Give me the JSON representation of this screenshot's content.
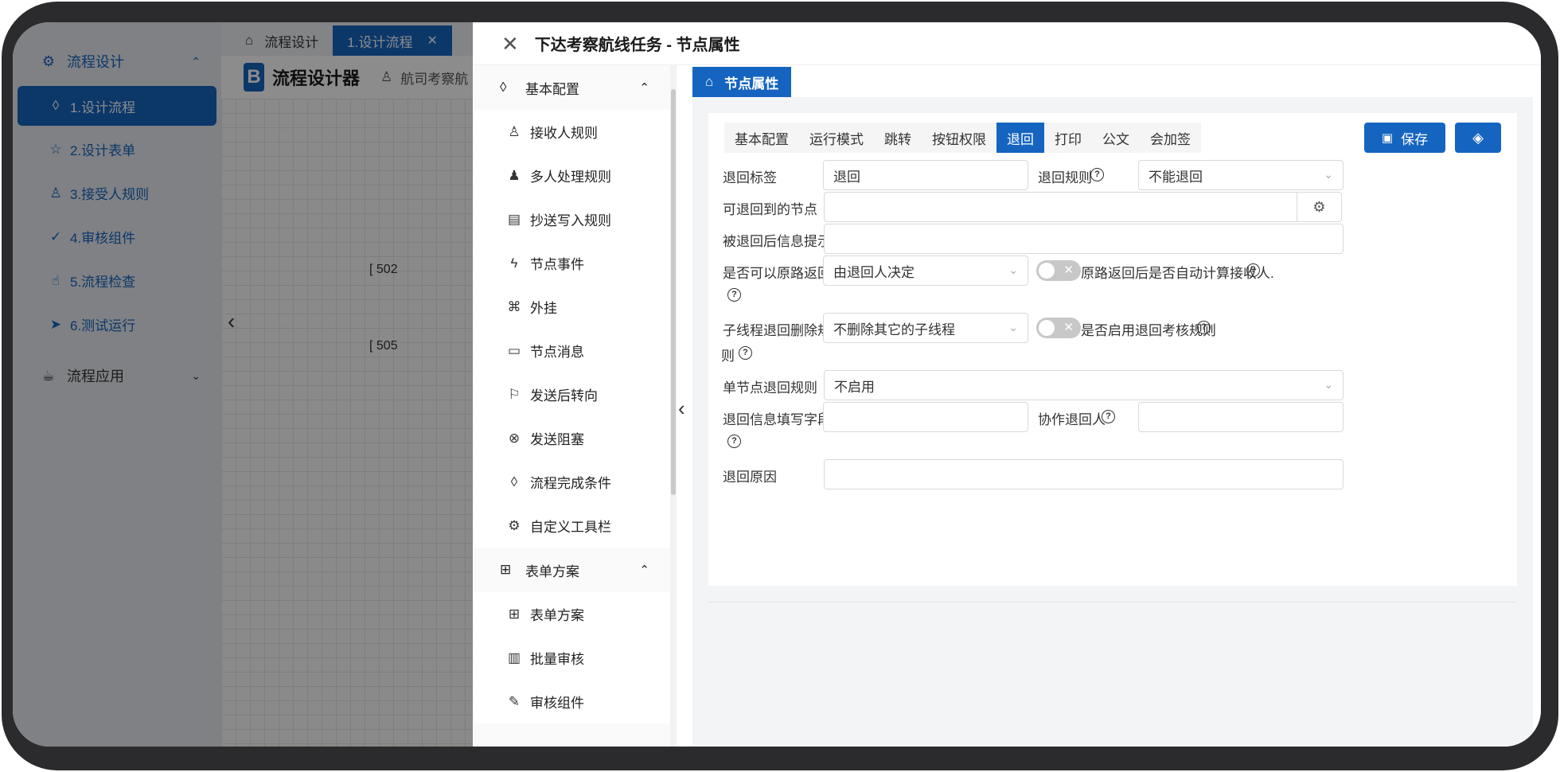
{
  "app": {
    "sidebar": {
      "group1": "流程设计",
      "items": [
        {
          "label": "1.设计流程",
          "icon": "droplet-icon"
        },
        {
          "label": "2.设计表单",
          "icon": "star-icon"
        },
        {
          "label": "3.接受人规则",
          "icon": "user-icon"
        },
        {
          "label": "4.审核组件",
          "icon": "check-circle-icon"
        },
        {
          "label": "5.流程检查",
          "icon": "thumb-icon"
        },
        {
          "label": "6.测试运行",
          "icon": "send-icon"
        }
      ],
      "group2": "流程应用"
    },
    "tabs": {
      "home": "流程设计",
      "active": "1.设计流程"
    },
    "designer": {
      "logo": "B",
      "title": "流程设计器",
      "subtitle": "航司考察航"
    },
    "canvas": {
      "node1": "[ 502",
      "node2": "[ 505"
    }
  },
  "drawer": {
    "title": "下达考察航线任务 - 节点属性",
    "nav": {
      "group_basic": "基本配置",
      "items": [
        {
          "label": "接收人规则",
          "icon": "user-icon"
        },
        {
          "label": "多人处理规则",
          "icon": "users-icon"
        },
        {
          "label": "抄送写入规则",
          "icon": "book-icon"
        },
        {
          "label": "节点事件",
          "icon": "bolt-icon"
        },
        {
          "label": "外挂",
          "icon": "plugin-icon"
        },
        {
          "label": "节点消息",
          "icon": "message-icon"
        },
        {
          "label": "发送后转向",
          "icon": "signpost-icon"
        },
        {
          "label": "发送阻塞",
          "icon": "block-icon"
        },
        {
          "label": "流程完成条件",
          "icon": "droplet-icon"
        },
        {
          "label": "自定义工具栏",
          "icon": "gear-icon"
        }
      ],
      "group_form": "表单方案",
      "form_items": [
        {
          "label": "表单方案",
          "icon": "grid-icon"
        },
        {
          "label": "批量审核",
          "icon": "batch-icon"
        },
        {
          "label": "审核组件",
          "icon": "edit-icon"
        }
      ]
    },
    "content_tab": "节点属性",
    "tabs": [
      "基本配置",
      "运行模式",
      "跳转",
      "按钮权限",
      "退回",
      "打印",
      "公文",
      "会加签"
    ],
    "active_tab": "退回",
    "save_label": "保存",
    "form": {
      "return_label_lbl": "退回标签",
      "return_label_val": "退回",
      "return_rule_lbl": "退回规则",
      "return_rule_val": "不能退回",
      "return_nodes_lbl": "可退回到的节点",
      "return_nodes_val": "",
      "after_return_tip_lbl": "被退回后信息提示",
      "after_return_tip_val": "",
      "orig_path_lbl": "是否可以原路返回",
      "orig_path_val": "由退回人决定",
      "orig_path_toggle_lbl": "原路返回后是否自动计算接收人.",
      "subthread_lbl_a": "子线程退回删除规",
      "subthread_lbl_b": "则",
      "subthread_val": "不删除其它的子线程",
      "assess_toggle_lbl": "是否启用退回考核规则",
      "single_node_lbl": "单节点退回规则",
      "single_node_val": "不启用",
      "info_field_lbl": "退回信息填写字段",
      "info_field_val": "",
      "coop_lbl": "协作退回人",
      "coop_val": "",
      "reason_lbl": "退回原因",
      "reason_val": ""
    }
  }
}
